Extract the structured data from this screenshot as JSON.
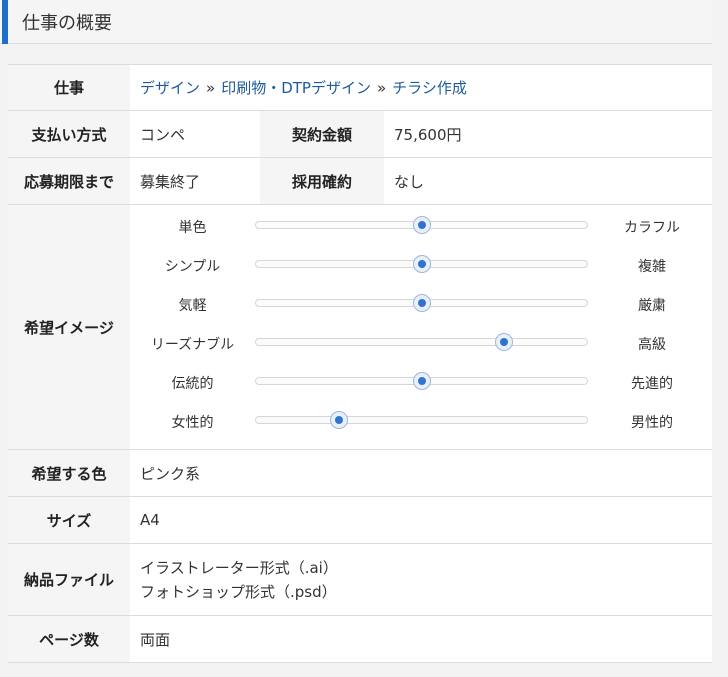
{
  "section": {
    "title": "仕事の概要"
  },
  "job": {
    "label": "仕事",
    "breadcrumb": [
      "デザイン",
      "印刷物・DTPデザイン",
      "チラシ作成"
    ],
    "separator": "»"
  },
  "payment": {
    "label": "支払い方式",
    "value": "コンペ",
    "amount_label": "契約金額",
    "amount_value": "75,600円"
  },
  "deadline": {
    "label": "応募期限まで",
    "value": "募集終了",
    "adoption_label": "採用確約",
    "adoption_value": "なし"
  },
  "image_pref": {
    "label": "希望イメージ",
    "sliders": [
      {
        "left": "単色",
        "right": "カラフル",
        "level": 0.5
      },
      {
        "left": "シンプル",
        "right": "複雑",
        "level": 0.5
      },
      {
        "left": "気軽",
        "right": "厳粛",
        "level": 0.5
      },
      {
        "left": "リーズナブル",
        "right": "高級",
        "level": 0.75
      },
      {
        "left": "伝統的",
        "right": "先進的",
        "level": 0.5
      },
      {
        "left": "女性的",
        "right": "男性的",
        "level": 0.25
      }
    ]
  },
  "color": {
    "label": "希望する色",
    "value": "ピンク系"
  },
  "size": {
    "label": "サイズ",
    "value": "A4"
  },
  "files": {
    "label": "納品ファイル",
    "lines": [
      "イラストレーター形式（.ai）",
      "フォトショップ形式（.psd）"
    ]
  },
  "pages": {
    "label": "ページ数",
    "value": "両面"
  },
  "colors": {
    "accent": "#1d6ecb",
    "link": "#1d5a9c",
    "knob": "#2f74d0"
  }
}
